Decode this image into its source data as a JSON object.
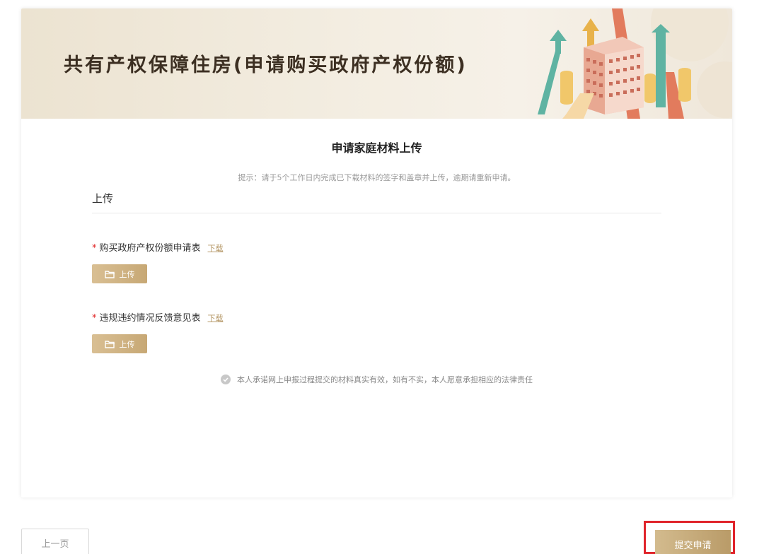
{
  "banner": {
    "title": "共有产权保障住房(申请购买政府产权份额)"
  },
  "section": {
    "title": "申请家庭材料上传",
    "tip": "提示：请于5个工作日内完成已下载材料的签字和盖章并上传，逾期请重新申请。",
    "upload_heading": "上传"
  },
  "fields": [
    {
      "required_mark": "*",
      "label": "购买政府产权份额申请表",
      "download_label": "下载",
      "upload_label": "上传"
    },
    {
      "required_mark": "*",
      "label": "违规违约情况反馈意见表",
      "download_label": "下载",
      "upload_label": "上传"
    }
  ],
  "promise": {
    "text": "本人承诺网上申报过程提交的材料真实有效，如有不实，本人愿意承担相应的法律责任"
  },
  "footer": {
    "prev_label": "上一页",
    "submit_label": "提交申请"
  },
  "colors": {
    "accent_gold": "#c7a875",
    "highlight_red": "#e0242b",
    "required_red": "#e02020"
  }
}
